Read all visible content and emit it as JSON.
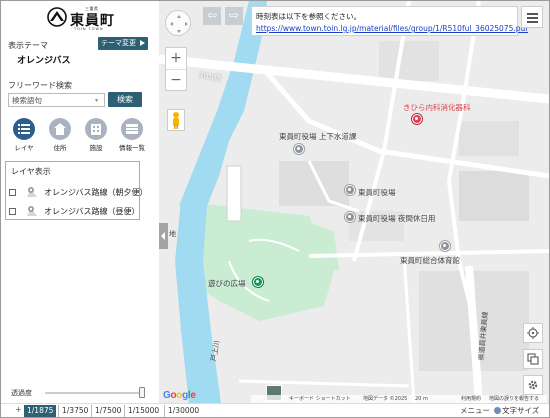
{
  "branding": {
    "small_text": "三重県",
    "town_name": "東員町",
    "roman_text": "TOIN TOWN"
  },
  "theme": {
    "label": "表示テーマ",
    "value": "オレンジバス",
    "change_button": "テーマ変更"
  },
  "search": {
    "label": "フリーワード検索",
    "placeholder": "検索語句",
    "button": "検索"
  },
  "toolbar": {
    "items": [
      {
        "label": "レイヤ",
        "icon": "list-icon",
        "active": true
      },
      {
        "label": "住所",
        "icon": "house-icon",
        "active": false
      },
      {
        "label": "施設",
        "icon": "building-icon",
        "active": false
      },
      {
        "label": "情報一覧",
        "icon": "table-icon",
        "active": false
      }
    ]
  },
  "layers": {
    "title": "レイヤ表示",
    "items": [
      {
        "label": "オレンジバス路線（朝夕便）",
        "checked": false
      },
      {
        "label": "オレンジバス路線（昼便）",
        "checked": false
      }
    ]
  },
  "opacity": {
    "label": "透過度",
    "value": 1.0
  },
  "scales": {
    "items": [
      "1/1875",
      "1/3750",
      "1/7500",
      "1/15000",
      "1/30000"
    ],
    "active": "1/1875"
  },
  "footer": {
    "help": "メニュー",
    "font_size": "文字サイズ"
  },
  "info_popup": {
    "text": "時刻表は以下を参照ください。",
    "link": "https://www.town.toin.lg.jp/material/files/group/1/R510ful_36025075.pdf"
  },
  "map": {
    "labels": {
      "bridge": "丸山橋",
      "clinic": "きひら内科消化器科",
      "water": "東員町役場 上下水道課",
      "townhall": "東員町役場",
      "night_window": "東員町役場 夜間休日用",
      "gym": "東員町総合体育館",
      "square": "遊びの広場",
      "river": "戸上川",
      "road": "県道員弁東員線",
      "edge_label": "地"
    },
    "attribution": {
      "shortcuts": "キーボード ショートカット",
      "map_data": "地図データ ©2025",
      "scale": "20 m",
      "terms": "利用規約",
      "report": "地図の誤りを報告する"
    },
    "google_logo": "Google",
    "colors": {
      "river": "#a1dbf2",
      "park": "#c9ecd3",
      "road": "#ffffff",
      "building": "#d9d9d9",
      "accent": "#2d5f75",
      "highlight": "#f0a12c"
    }
  }
}
